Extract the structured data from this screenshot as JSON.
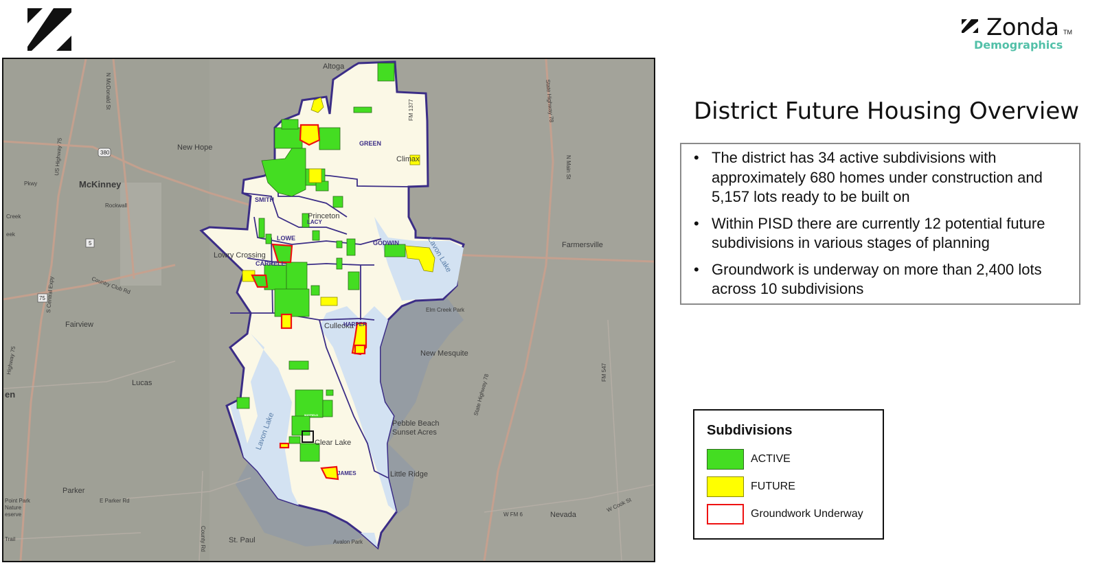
{
  "header": {
    "corner_logo_icon": "zonda-slash-logo-icon",
    "brand_name": "Zonda",
    "brand_tm": "TM",
    "brand_sub": "Demographics",
    "brand_color": "#52c0a8"
  },
  "panel": {
    "title": "District Future Housing Overview",
    "bullets": [
      "The district has 34 active subdivisions with approximately 680 homes under construction and 5,157 lots ready to be built on",
      "Within PISD there are currently 12 potential future subdivisions in various stages of planning",
      "Groundwork is underway on more than 2,400 lots across 10 subdivisions"
    ],
    "bullet_char": "•"
  },
  "legend": {
    "title": "Subdivisions",
    "items": [
      {
        "label": "ACTIVE",
        "color": "#44dd22"
      },
      {
        "label": "FUTURE",
        "color": "#ffff00"
      },
      {
        "label": "Groundwork Underway",
        "color": "#ee1111"
      }
    ]
  },
  "map": {
    "colors": {
      "background": "#a3a39a",
      "district": "#fbf8e6",
      "lake": "#d3e2f2",
      "boundary": "#3b2d86",
      "road": "#c8a08e"
    },
    "labels": {
      "altoga": "Altoga",
      "new_hope": "New Hope",
      "mckinney": "McKinney",
      "rockwall": "Rockwall",
      "creek": "Creek",
      "eek": "eek",
      "pkwy": "Pkwy",
      "climax": "Climax",
      "princeton": "Princeton",
      "lowry_crossing": "Lowry Crossing",
      "farmersville": "Farmersville",
      "country_club": "Country Club Rd",
      "fairview": "Fairview",
      "elm_creek": "Elm Creek Park",
      "cullera": "Culleoka",
      "new_mesquite": "New Mesquite",
      "lucas": "Lucas",
      "en": "en",
      "pebble_beach": "Pebble Beach",
      "sunset_acres": "Sunset Acres",
      "clear_lake": "Clear Lake",
      "lavon_lake_w": "Lavon Lake",
      "lavon_lake_e": "Lavon Lake",
      "little_ridge": "Little Ridge",
      "parker": "Parker",
      "parker_rd": "E Parker Rd",
      "point_park": "Point Park",
      "nature": "Nature",
      "reserve": "eserve",
      "nevada": "Nevada",
      "trail": "Trail",
      "st_paul": "St. Paul",
      "avalon_park": "Avalon Park",
      "mcdonald": "N McDonald St",
      "us75": "US Highway 75",
      "central_expy": "S Central Expy",
      "state_hwy78": "State Highway 78",
      "n_main": "N Main St",
      "fm1377": "FM 1377",
      "state_hwy78b": "State Highway 78",
      "fm547": "FM 547",
      "hwy75b": "Highway 75",
      "county_rd": "County Rd",
      "w_fm6": "W FM 6",
      "w_cook": "W Cook St",
      "shield_380": "380",
      "shield_5": "5",
      "shield_75": "75"
    },
    "zones": {
      "green": "GREEN",
      "smith": "SMITH",
      "lacy": "LACY",
      "lowe": "LOWE",
      "godwin": "GODWIN",
      "carrell": "CARRELL",
      "harper": "HARPER",
      "mayfield": "MAYFIELD",
      "james": "JAMES"
    }
  }
}
